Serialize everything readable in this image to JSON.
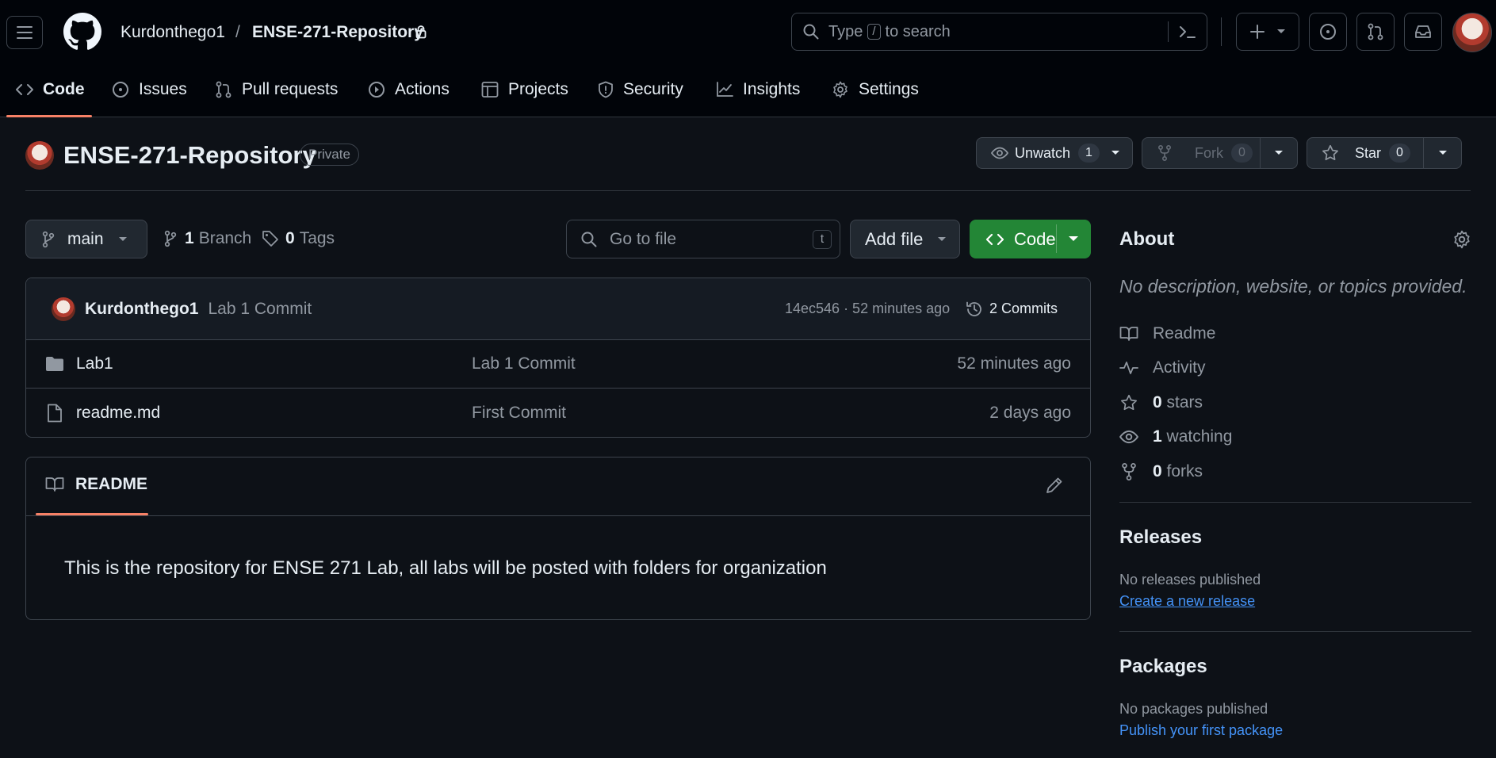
{
  "header": {
    "owner": "Kurdonthego1",
    "separator": "/",
    "repo": "ENSE-271-Repository",
    "search_type": "Type",
    "search_key": "/",
    "search_rest": "to search"
  },
  "tabs": [
    {
      "label": "Code",
      "icon": "code-icon"
    },
    {
      "label": "Issues",
      "icon": "issue-icon"
    },
    {
      "label": "Pull requests",
      "icon": "pull-request-icon"
    },
    {
      "label": "Actions",
      "icon": "play-icon"
    },
    {
      "label": "Projects",
      "icon": "table-icon"
    },
    {
      "label": "Security",
      "icon": "shield-icon"
    },
    {
      "label": "Insights",
      "icon": "graph-icon"
    },
    {
      "label": "Settings",
      "icon": "gear-icon"
    }
  ],
  "repo": {
    "name": "ENSE-271-Repository",
    "visibility": "Private",
    "unwatch_label": "Unwatch",
    "unwatch_count": "1",
    "fork_label": "Fork",
    "fork_count": "0",
    "star_label": "Star",
    "star_count": "0"
  },
  "toolbar": {
    "branch": "main",
    "branch_count": "1",
    "branch_label": "Branch",
    "tag_count": "0",
    "tag_label": "Tags",
    "goto_placeholder": "Go to file",
    "goto_key": "t",
    "add_file": "Add file",
    "code": "Code"
  },
  "commit": {
    "author": "Kurdonthego1",
    "message": "Lab 1 Commit",
    "meta": "14ec546 · 52 minutes ago",
    "count_label": "2 Commits"
  },
  "files": [
    {
      "type": "folder",
      "name": "Lab1",
      "message": "Lab 1 Commit",
      "age": "52 minutes ago"
    },
    {
      "type": "file",
      "name": "readme.md",
      "message": "First Commit",
      "age": "2 days ago"
    }
  ],
  "readme": {
    "tab_label": "README",
    "body": "This is the repository for ENSE 271 Lab, all labs will be posted with folders for organization"
  },
  "about": {
    "heading": "About",
    "description": "No description, website, or topics provided.",
    "readme": "Readme",
    "activity": "Activity",
    "stars_count": "0",
    "stars_label": "stars",
    "watching_count": "1",
    "watching_label": "watching",
    "forks_count": "0",
    "forks_label": "forks"
  },
  "releases": {
    "heading": "Releases",
    "empty": "No releases published",
    "link": "Create a new release"
  },
  "packages": {
    "heading": "Packages",
    "empty": "No packages published",
    "link": "Publish your first package"
  },
  "colors": {
    "background": "#0d1117",
    "header": "#010409",
    "accent_underline": "#f78166",
    "code_button": "#238636",
    "link": "#4493f8"
  }
}
